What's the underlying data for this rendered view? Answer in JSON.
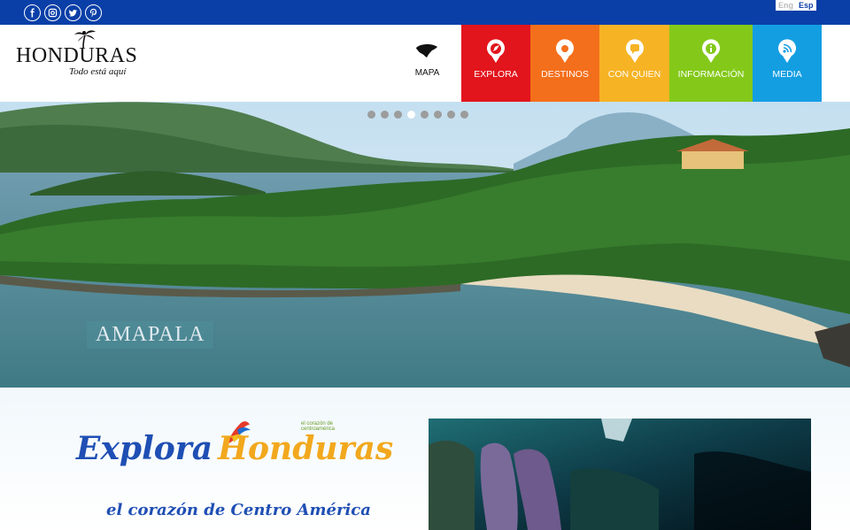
{
  "topbar": {
    "social": [
      {
        "icon": "facebook-icon"
      },
      {
        "icon": "instagram-icon"
      },
      {
        "icon": "twitter-icon"
      },
      {
        "icon": "pinterest-icon"
      }
    ],
    "lang": {
      "eng": "Eng",
      "esp": "Esp"
    }
  },
  "header": {
    "logo": {
      "word": "HONDURAS",
      "tagline": "Todo está aquí"
    },
    "mapa": {
      "label": "MAPA"
    },
    "nav": [
      {
        "label": "EXPLORA",
        "color": "#e2141c",
        "icon": "compass-icon"
      },
      {
        "label": "DESTINOS",
        "color": "#f46f1b",
        "icon": "map-pin-icon"
      },
      {
        "label": "CON QUIEN",
        "color": "#f6b324",
        "icon": "chat-icon"
      },
      {
        "label": "INFORMACIÓN",
        "color": "#84c91a",
        "icon": "info-icon"
      },
      {
        "label": "MEDIA",
        "color": "#149ee2",
        "icon": "rss-icon"
      }
    ]
  },
  "hero": {
    "caption": "AMAPALA",
    "slide_count": 8,
    "active_slide": 4
  },
  "promo": {
    "explora": "Explora",
    "honduras": "Honduras",
    "small": "el corazón de centroamérica",
    "tagline": "el corazón de Centro América"
  }
}
